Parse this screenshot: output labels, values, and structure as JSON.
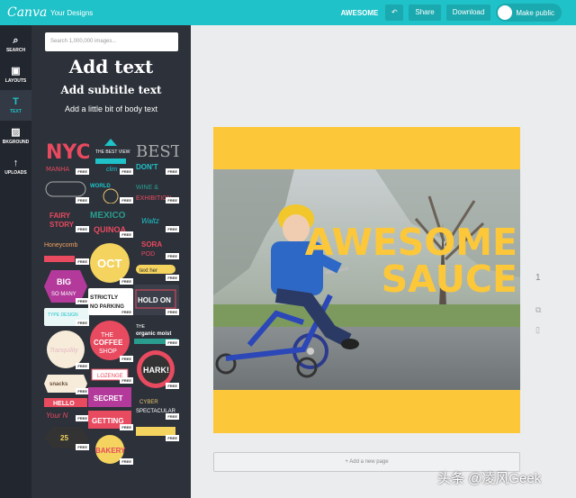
{
  "topbar": {
    "logo": "Canva",
    "your_designs": "Your Designs",
    "design_name": "AWESOME",
    "undo_icon": "undo-icon",
    "share": "Share",
    "download": "Download",
    "make_public": "Make public"
  },
  "rail": {
    "items": [
      {
        "label": "SEARCH",
        "icon": "⌕",
        "icon_name": "search-icon"
      },
      {
        "label": "LAYOUTS",
        "icon": "▣",
        "icon_name": "layouts-icon"
      },
      {
        "label": "TEXT",
        "icon": "T",
        "icon_name": "text-icon"
      },
      {
        "label": "BKGROUND",
        "icon": "▨",
        "icon_name": "background-icon"
      },
      {
        "label": "UPLOADS",
        "icon": "↑",
        "icon_name": "upload-icon"
      }
    ]
  },
  "panel": {
    "search_placeholder": "Search 1,000,000 images...",
    "add_heading": "Add text",
    "add_subheading": "Add subtitle text",
    "add_body": "Add a little bit of body text",
    "free_label": "FREE",
    "thumb_texts": [
      "NYC",
      "BEST",
      "OCT",
      "HOLD ON",
      "BIG",
      "STRICTLY NO PARKING",
      "THE COFFEE SHOP",
      "HARK!",
      "SECRET",
      "GETTING",
      "BAKERY",
      "HELLO",
      "WORLD",
      "MEXICO",
      "QUINOA",
      "Honeycomb",
      "25"
    ]
  },
  "canvas": {
    "headline_1": "AWESOME",
    "headline_2": "SAUCE",
    "page_number": "1",
    "add_page": "+ Add a new page",
    "copy_icon": "copy-icon",
    "delete_icon": "trash-icon"
  },
  "watermark": "头条 @凌风Geek",
  "colors": {
    "brand": "#1fc2c8",
    "panel": "#2c313a",
    "rail": "#22262e",
    "accent_yellow": "#fcc839"
  }
}
